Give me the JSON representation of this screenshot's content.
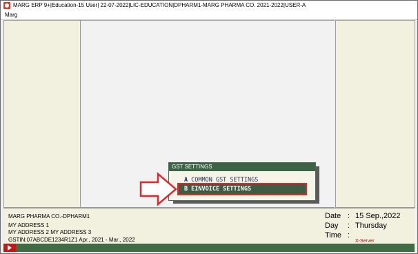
{
  "window": {
    "title": "MARG ERP 9+|Education-15 User| 22-07-2022|LIC-EDUCATION|DPHARM1-MARG PHARMA CO. 2021-2022|USER-A"
  },
  "menubar": {
    "items": [
      "Marg"
    ]
  },
  "gst_menu": {
    "title": "GST SETTINGS",
    "options": [
      {
        "key": "A",
        "label": "COMMON GST SETTINGS",
        "selected": false
      },
      {
        "key": "B",
        "label": "EINVOICE SETTINGS",
        "selected": true
      }
    ]
  },
  "company": {
    "name": "MARG PHARMA CO.-DPHARM1",
    "address1": "MY ADDRESS 1",
    "address2": "MY ADDRESS 2 MY ADDRESS 3",
    "gstin_line": "GSTIN:07ABCDE1234R1Z1  Apr., 2021 - Mar., 2022"
  },
  "datetime": {
    "date_label": "Date",
    "date_value": "15 Sep.,2022",
    "day_label": "Day",
    "day_value": "Thursday",
    "time_label": "Time",
    "time_value": "",
    "colon": ":"
  },
  "server": {
    "label": "X-Server"
  },
  "colors": {
    "highlight_border": "#e0282a",
    "menu_header": "#3d6346",
    "panel_bg": "#f2f0df",
    "arrow": "#e0282a"
  },
  "icons": {
    "app": "marg-app-icon",
    "play": "play-icon",
    "pointer": "outline-arrow-icon"
  }
}
